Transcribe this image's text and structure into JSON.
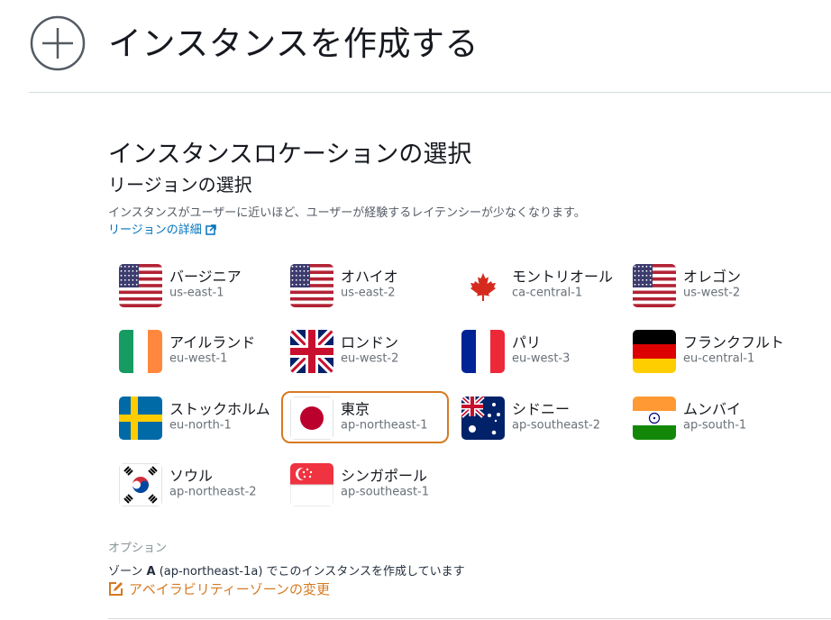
{
  "header": {
    "title": "インスタンスを作成する"
  },
  "location": {
    "section_title": "インスタンスロケーションの選択",
    "region_heading": "リージョンの選択",
    "description": "インスタンスがユーザーに近いほど、ユーザーが経験するレイテンシーが少なくなります。",
    "region_link": "リージョンの詳細"
  },
  "regions": [
    {
      "name": "バージニア",
      "code": "us-east-1",
      "flag": "us-flag-icon"
    },
    {
      "name": "オハイオ",
      "code": "us-east-2",
      "flag": "us-flag-icon"
    },
    {
      "name": "モントリオール",
      "code": "ca-central-1",
      "flag": "canada-flag-icon"
    },
    {
      "name": "オレゴン",
      "code": "us-west-2",
      "flag": "us-flag-icon"
    },
    {
      "name": "アイルランド",
      "code": "eu-west-1",
      "flag": "ireland-flag-icon"
    },
    {
      "name": "ロンドン",
      "code": "eu-west-2",
      "flag": "uk-flag-icon"
    },
    {
      "name": "パリ",
      "code": "eu-west-3",
      "flag": "france-flag-icon"
    },
    {
      "name": "フランクフルト",
      "code": "eu-central-1",
      "flag": "germany-flag-icon"
    },
    {
      "name": "ストックホルム",
      "code": "eu-north-1",
      "flag": "sweden-flag-icon"
    },
    {
      "name": "東京",
      "code": "ap-northeast-1",
      "flag": "japan-flag-icon",
      "selected": true
    },
    {
      "name": "シドニー",
      "code": "ap-southeast-2",
      "flag": "australia-flag-icon"
    },
    {
      "name": "ムンバイ",
      "code": "ap-south-1",
      "flag": "india-flag-icon"
    },
    {
      "name": "ソウル",
      "code": "ap-northeast-2",
      "flag": "korea-flag-icon"
    },
    {
      "name": "シンガポール",
      "code": "ap-southeast-1",
      "flag": "singapore-flag-icon"
    }
  ],
  "options": {
    "label": "オプション",
    "zone_prefix": "ゾーン",
    "zone_letter": "A",
    "zone_suffix": "(ap-northeast-1a) でこのインスタンスを作成しています",
    "change_link": "アベイラビリティーゾーンの変更"
  },
  "colors": {
    "accent": "#d67a22",
    "link": "#0073bb"
  }
}
